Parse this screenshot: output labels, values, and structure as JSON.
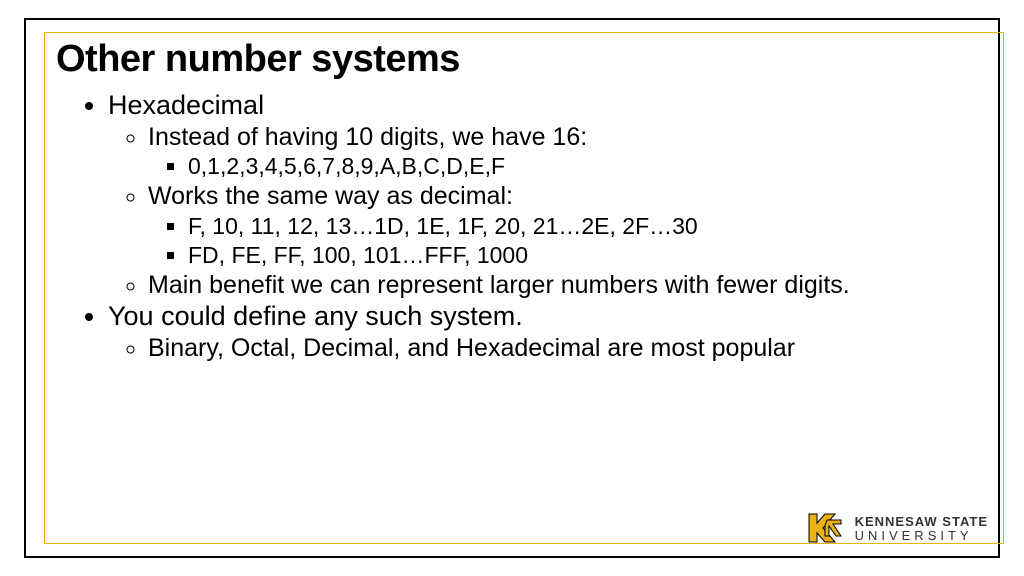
{
  "title": "Other number systems",
  "bullets": {
    "hexadecimal": {
      "label": "Hexadecimal",
      "sub": {
        "digits_intro": "Instead of having 10 digits, we have 16:",
        "digits_list": "0,1,2,3,4,5,6,7,8,9,A,B,C,D,E,F",
        "works_intro": "Works the same way as decimal:",
        "works_seq1": "F, 10, 11, 12, 13…1D, 1E, 1F, 20, 21…2E, 2F…30",
        "works_seq2": "FD, FE, FF, 100, 101…FFF, 1000",
        "benefit": "Main benefit we can represent larger numbers with fewer digits."
      }
    },
    "anysystem": {
      "label": "You could define any such system.",
      "sub": {
        "popular": "Binary, Octal, Decimal, and Hexadecimal are most popular"
      }
    }
  },
  "logo": {
    "line1": "KENNESAW STATE",
    "line2": "UNIVERSITY"
  }
}
